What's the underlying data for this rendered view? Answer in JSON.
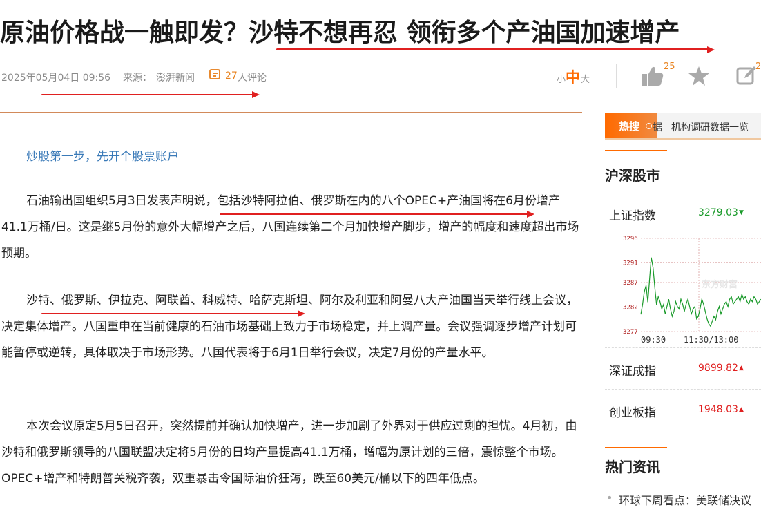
{
  "article": {
    "title": "原油价格战一触即发？沙特不想再忍 领衔多个产油国加速增产",
    "datetime": "2025年05月04日 09:56",
    "source_label": "来源：",
    "source": "澎湃新闻",
    "comments_count": "27",
    "comments_suffix": "人评论",
    "font_small": "小",
    "font_mid": "中",
    "font_large": "大",
    "like_count": "25",
    "share_count": "2",
    "promo_link": "炒股第一步，先开个股票账户",
    "paragraphs": [
      "石油输出国组织5月3日发表声明说，包括沙特阿拉伯、俄罗斯在内的八个OPEC+产油国将在6月份增产41.1万桶/日。这是继5月份的意外大幅增产之后，八国连续第二个月加快增产脚步，增产的幅度和速度超出市场预期。",
      "沙特、俄罗斯、伊拉克、阿联酋、科威特、哈萨克斯坦、阿尔及利亚和阿曼八大产油国当天举行线上会议，决定集体增产。八国重申在当前健康的石油市场基础上致力于市场稳定，并上调产量。会议强调逐步增产计划可能暂停或逆转，具体取决于市场形势。八国代表将于6月1日举行会议，决定7月份的产量水平。",
      "本次会议原定5月5日召开，突然提前并确认加快增产，进一步加剧了外界对于供应过剩的担忧。4月初，由沙特和俄罗斯领导的八国联盟决定将5月份的日均产量提高41.1万桶，增幅为原计划的三倍，震惊整个市场。OPEC+增产和特朗普关税齐袭，双重暴击令国际油价狂泻，跌至60美元/桶以下的四年低点。"
    ]
  },
  "sidebar": {
    "hot_search_label": "热搜",
    "hot_search_partial": "据",
    "hot_search_item": "机构调研数据一览",
    "market_title": "沪深股市",
    "indices": [
      {
        "name": "上证指数",
        "value": "3279.03",
        "arrow": "▼",
        "color": "#1a9a2a"
      },
      {
        "name": "深证成指",
        "value": "9899.82",
        "arrow": "▲",
        "color": "#e02020"
      },
      {
        "name": "创业板指",
        "value": "1948.03",
        "arrow": "▲",
        "color": "#e02020"
      }
    ],
    "news_title": "热门资讯",
    "news_items": [
      "环球下周看点：美联储决议"
    ]
  },
  "chart_data": {
    "type": "line",
    "title": "",
    "watermark": "东方财富",
    "y_ticks": [
      "3296",
      "3291",
      "3287",
      "3282",
      "3277"
    ],
    "ylim": [
      3277,
      3296
    ],
    "x_ticks": [
      "09:30",
      "11:30/13:00"
    ],
    "series": [
      {
        "values": [
          3280.5,
          3282.5,
          3285.1,
          3286.4,
          3283.0,
          3287.6,
          3292.1,
          3290.0,
          3286.0,
          3282.5,
          3284.1,
          3283.1,
          3281.6,
          3282.5,
          3280.6,
          3282.1,
          3283.6,
          3281.6,
          3280.1,
          3281.1,
          3283.1,
          3282.1,
          3281.6,
          3283.6,
          3282.6,
          3281.1,
          3282.6,
          3283.6,
          3282.1,
          3280.6,
          3281.6,
          3282.1,
          3279.6,
          3280.1,
          3281.6,
          3283.6,
          3282.6,
          3281.1,
          3279.6,
          3278.6,
          3278.1,
          3279.1,
          3280.1,
          3279.4,
          3281.1,
          3282.1,
          3280.6,
          3281.6,
          3282.6,
          3283.1,
          3282.1,
          3283.6,
          3284.1,
          3282.6,
          3283.1,
          3283.6,
          3284.1,
          3283.1,
          3284.6,
          3283.6,
          3284.1,
          3283.1,
          3282.6,
          3283.6,
          3283.1,
          3284.1,
          3283.6,
          3282.6,
          3283.1,
          3283.6
        ]
      }
    ]
  },
  "colors": {
    "accent": "#e02020",
    "brand_orange": "#ff6a00",
    "green": "#1a9a2a",
    "link_blue": "#3a7ab8"
  }
}
